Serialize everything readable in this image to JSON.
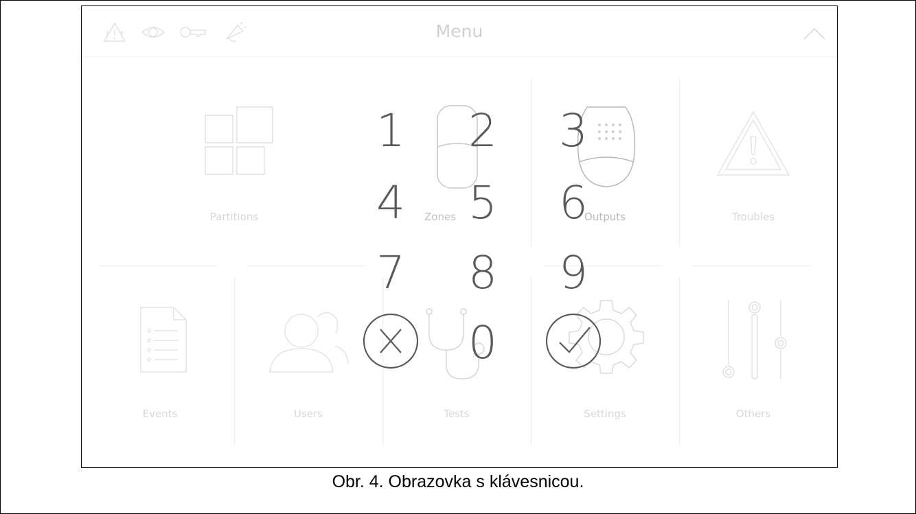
{
  "header": {
    "title": "Menu"
  },
  "status_icons": [
    "alarm-warning-icon",
    "eye-icon",
    "key-icon",
    "siren-icon"
  ],
  "menu_tiles": [
    {
      "label": "Partitions",
      "icon": "partitions-icon"
    },
    {
      "label": "Zones",
      "icon": "zone-detector-icon"
    },
    {
      "label": "Outputs",
      "icon": "siren-outputs-icon"
    },
    {
      "label": "Troubles",
      "icon": "warning-triangle-icon"
    },
    {
      "label": "Events",
      "icon": "event-list-icon"
    },
    {
      "label": "Users",
      "icon": "users-icon"
    },
    {
      "label": "Tests",
      "icon": "stethoscope-icon"
    },
    {
      "label": "Settings",
      "icon": "gear-icon"
    },
    {
      "label": "Others",
      "icon": "sliders-icon"
    }
  ],
  "keypad": {
    "keys": [
      "1",
      "2",
      "3",
      "4",
      "5",
      "6",
      "7",
      "8",
      "9",
      "0"
    ],
    "cancel_icon": "cancel-x-icon",
    "confirm_icon": "confirm-check-icon"
  },
  "caption": "Obr. 4. Obrazovka s klávesnicou.",
  "colors": {
    "keypad_text": "#5a5a5a",
    "faded_icons": "#e0e0e0",
    "title": "#d0d0d0"
  }
}
